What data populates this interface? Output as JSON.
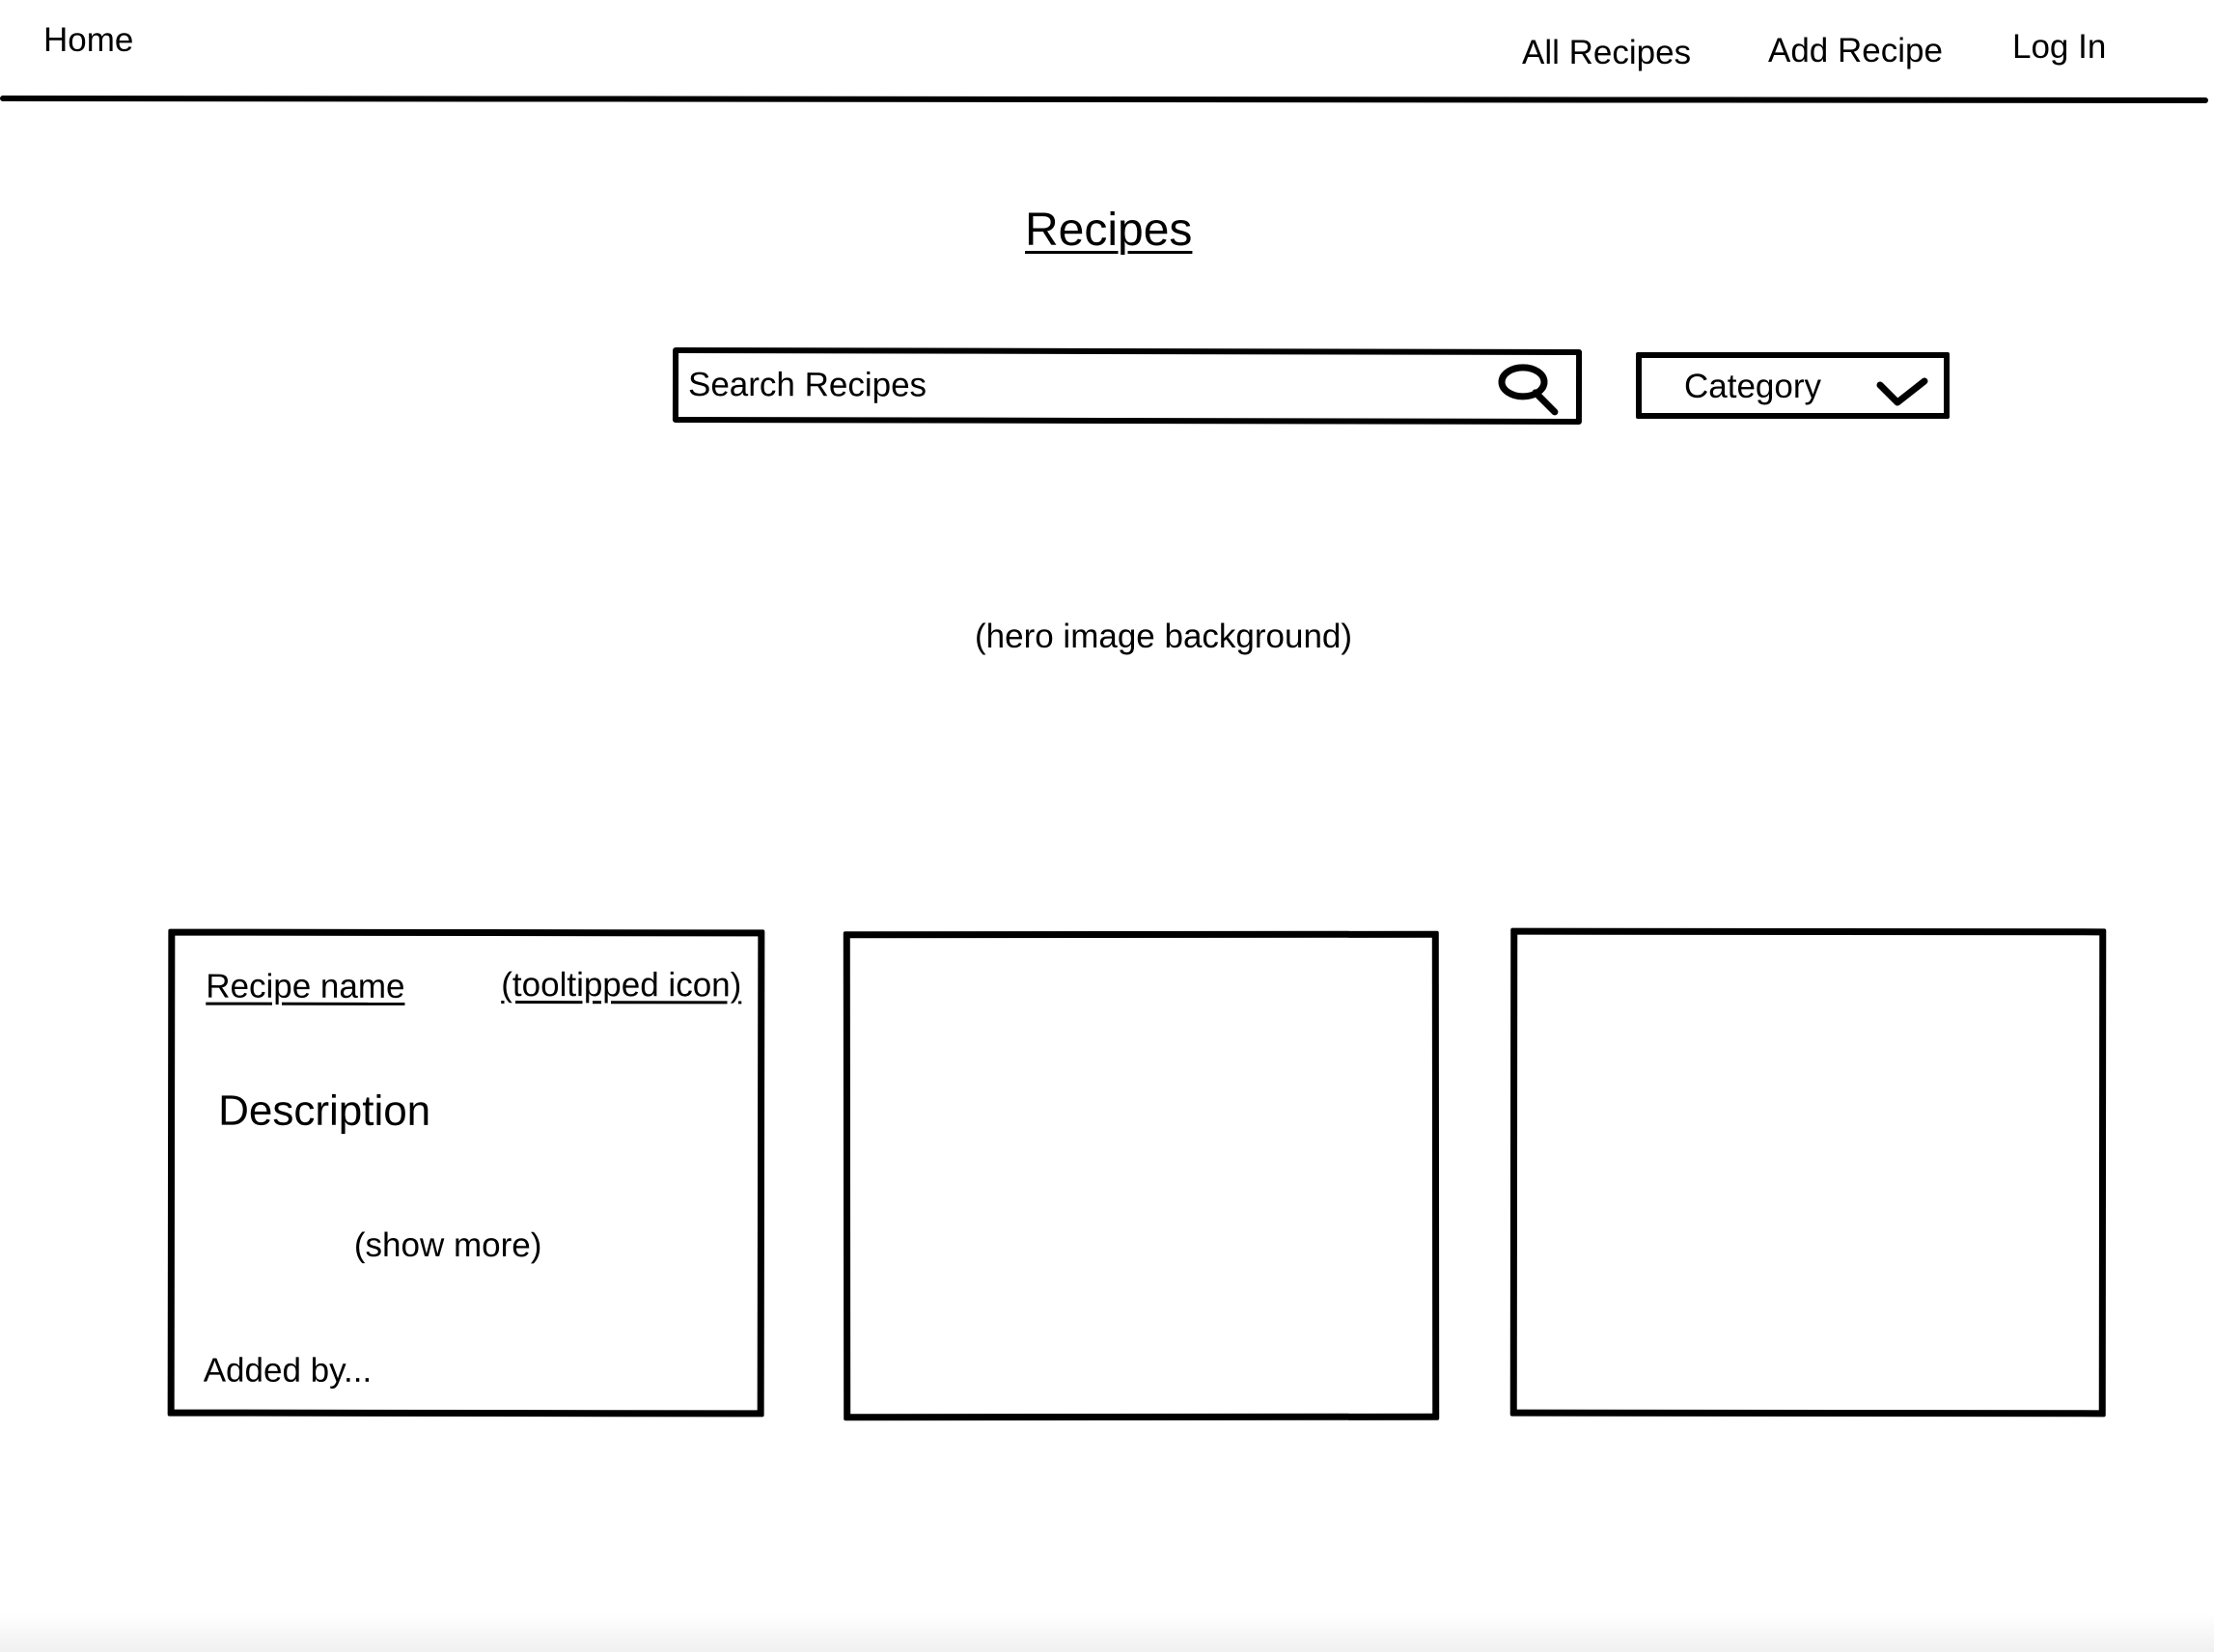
{
  "nav": {
    "home": "Home",
    "all_recipes": "All Recipes",
    "add_recipe": "Add Recipe",
    "log_in": "Log In"
  },
  "page": {
    "title": "Recipes"
  },
  "search": {
    "placeholder": "Search Recipes",
    "icon": "search-icon"
  },
  "category": {
    "label": "Category",
    "icon": "chevron-down-icon"
  },
  "hero": {
    "note": "(hero image background)"
  },
  "cards": [
    {
      "name": "Recipe name",
      "tooltip": "(tooltipped icon)",
      "description": "Description",
      "show_more": "(show more)",
      "added_by": "Added by..."
    },
    {},
    {}
  ]
}
